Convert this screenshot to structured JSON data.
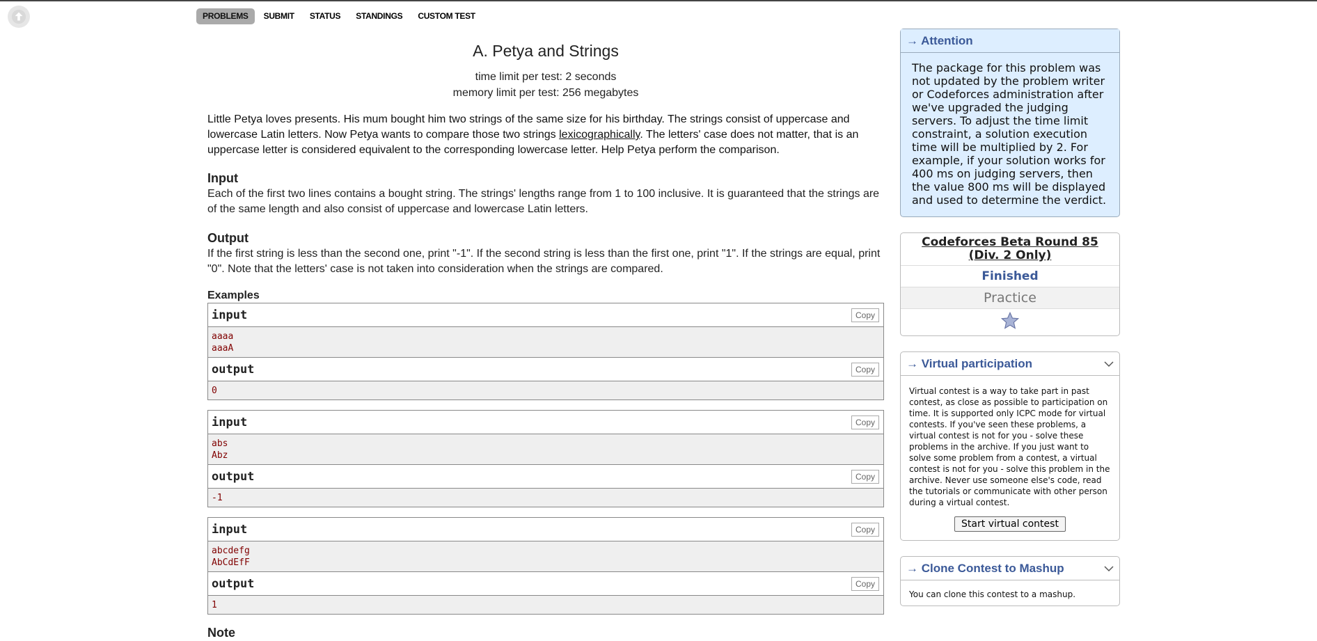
{
  "nav": {
    "items": [
      {
        "label": "PROBLEMS",
        "active": true
      },
      {
        "label": "SUBMIT"
      },
      {
        "label": "STATUS"
      },
      {
        "label": "STANDINGS"
      },
      {
        "label": "CUSTOM TEST"
      }
    ]
  },
  "problem": {
    "title": "A. Petya and Strings",
    "time_limit": "time limit per test: 2 seconds",
    "memory_limit": "memory limit per test: 256 megabytes",
    "legend_part1": "Little Petya loves presents. His mum bought him two strings of the same size for his birthday. The strings consist of uppercase and lowercase Latin letters. Now Petya wants to compare those two strings ",
    "legend_link": "lexicographically",
    "legend_part2": ". The letters' case does not matter, that is an uppercase letter is considered equivalent to the corresponding lowercase letter. Help Petya perform the comparison.",
    "input_title": "Input",
    "input_text": "Each of the first two lines contains a bought string. The strings' lengths range from 1 to 100 inclusive. It is guaranteed that the strings are of the same length and also consist of uppercase and lowercase Latin letters.",
    "output_title": "Output",
    "output_text": "If the first string is less than the second one, print \"-1\". If the second string is less than the first one, print \"1\". If the strings are equal, print \"0\". Note that the letters' case is not taken into consideration when the strings are compared.",
    "examples_title": "Examples",
    "input_label": "input",
    "output_label": "output",
    "copy_label": "Copy",
    "samples": [
      {
        "input": [
          "aaaa",
          "aaaA"
        ],
        "output": [
          "0"
        ]
      },
      {
        "input": [
          "abs",
          "Abz"
        ],
        "output": [
          "-1"
        ]
      },
      {
        "input": [
          "abcdefg",
          "AbCdEfF"
        ],
        "output": [
          "1"
        ]
      }
    ],
    "note_title": "Note"
  },
  "sidebar": {
    "attention_title": "→ Attention",
    "attention_text": "The package for this problem was not updated by the problem writer or Codeforces administration after we've upgraded the judging servers. To adjust the time limit constraint, a solution execution time will be multiplied by 2. For example, if your solution works for 400 ms on judging servers, then the value 800 ms will be displayed and used to determine the verdict.",
    "round_name": "Codeforces Beta Round 85 (Div. 2 Only)",
    "round_status": "Finished",
    "round_phase": "Practice",
    "virtual_title": "→ Virtual participation",
    "virtual_text": "Virtual contest is a way to take part in past contest, as close as possible to participation on time. It is supported only ICPC mode for virtual contests. If you've seen these problems, a virtual contest is not for you - solve these problems in the archive. If you just want to solve some problem from a contest, a virtual contest is not for you - solve this problem in the archive. Never use someone else's code, read the tutorials or communicate with other person during a virtual contest.",
    "virtual_button": "Start virtual contest",
    "clone_title": "→ Clone Contest to Mashup",
    "clone_text": "You can clone this contest to a mashup."
  }
}
